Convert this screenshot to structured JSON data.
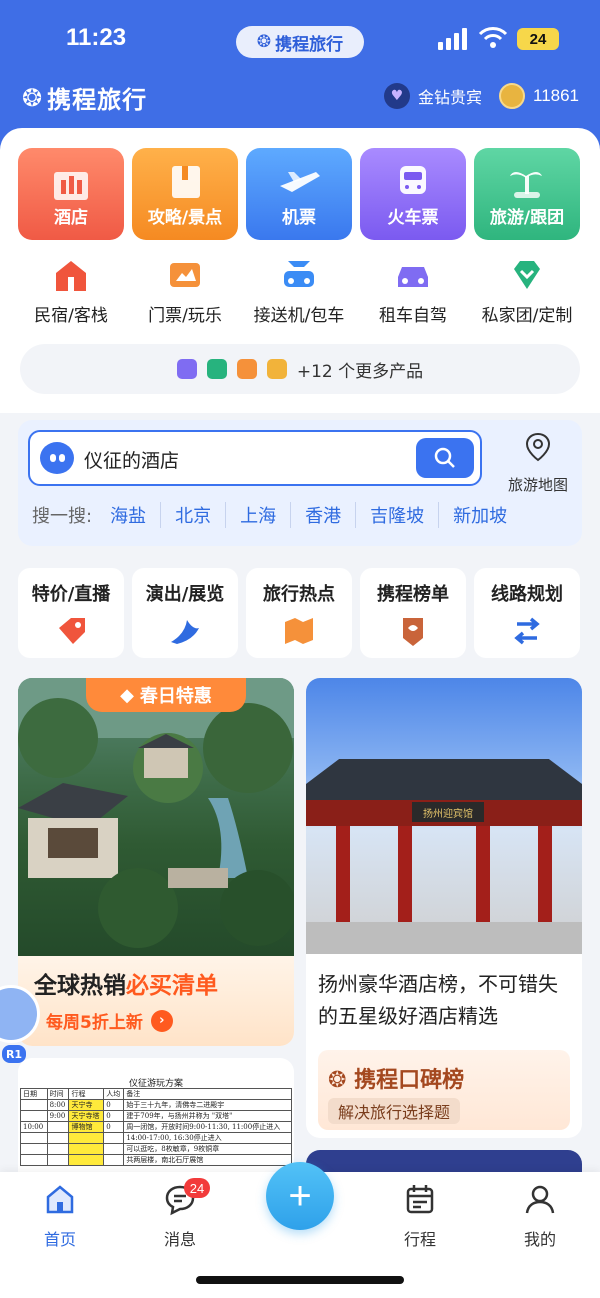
{
  "status_bar": {
    "time": "11:23",
    "battery": "24"
  },
  "header": {
    "app_pill": "携程旅行",
    "brand": "携程旅行",
    "vip_label": "金钻贵宾",
    "points": "11861"
  },
  "main_tiles": [
    {
      "label": "酒店",
      "icon": "hotel-icon"
    },
    {
      "label": "攻略/景点",
      "icon": "guide-icon"
    },
    {
      "label": "机票",
      "icon": "plane-icon"
    },
    {
      "label": "火车票",
      "icon": "train-icon"
    },
    {
      "label": "旅游/跟团",
      "icon": "palm-icon"
    }
  ],
  "sub_tiles": [
    {
      "label": "民宿/客栈",
      "icon": "house-icon"
    },
    {
      "label": "门票/玩乐",
      "icon": "ticket-icon"
    },
    {
      "label": "接送机/包车",
      "icon": "car-transfer-icon"
    },
    {
      "label": "租车自驾",
      "icon": "rental-car-icon"
    },
    {
      "label": "私家团/定制",
      "icon": "diamond-icon"
    }
  ],
  "more_products": "+12 个更多产品",
  "search": {
    "query": "仪征的酒店",
    "map_label": "旅游地图",
    "hot_label": "搜一搜:",
    "hot_keywords": [
      "海盐",
      "北京",
      "上海",
      "香港",
      "吉隆坡",
      "新加坡"
    ]
  },
  "quick_cards": [
    {
      "label": "特价/直播",
      "icon": "price-tag-icon"
    },
    {
      "label": "演出/展览",
      "icon": "show-icon"
    },
    {
      "label": "旅行热点",
      "icon": "map-fold-icon"
    },
    {
      "label": "携程榜单",
      "icon": "ranking-icon"
    },
    {
      "label": "线路规划",
      "icon": "route-icon"
    }
  ],
  "feed": {
    "left_tag": "春日特惠",
    "left_title_1": "全球热销",
    "left_title_2": "必买清单",
    "left_sub": "每周5折上新",
    "doc_title": "仪征游玩方案",
    "doc_header": [
      "日期",
      "时间",
      "行程",
      "人均",
      "备注"
    ],
    "doc_rows": [
      [
        "",
        "8:00",
        "天宁寺",
        "0",
        "始于三十九年，清佛寺二进殿宇"
      ],
      [
        "",
        "9:00",
        "天宁寺塔",
        "0",
        "建于709年，与扬州并称为 \"双塔\""
      ],
      [
        "10:00",
        "",
        "博物馆",
        "0",
        "周一闭馆，开放时间9:00-11:30, 11:00停止进入"
      ],
      [
        "",
        "",
        "",
        "",
        "14:00-17:00, 16:30停止进入"
      ],
      [
        "",
        "",
        "",
        "",
        "可以逛吃，8枚敏章，9枚铜章"
      ],
      [
        "",
        "",
        "",
        "",
        "共两层楼，南北石厅展馆"
      ]
    ],
    "right_sign": "扬州迎宾馆",
    "right_desc": "扬州豪华酒店榜，不可错失的五星级好酒店精选",
    "rank_title": "携程口碑榜",
    "rank_sub": "解决旅行选择题"
  },
  "mascot_badge": "R1",
  "bottom_nav": [
    {
      "label": "首页",
      "icon": "home-icon",
      "active": true
    },
    {
      "label": "消息",
      "icon": "message-icon",
      "badge": "24"
    },
    {
      "label": "",
      "icon": "plus-icon"
    },
    {
      "label": "行程",
      "icon": "calendar-icon"
    },
    {
      "label": "我的",
      "icon": "user-icon"
    }
  ],
  "colors": {
    "brand_blue": "#3f6ee6",
    "accent_orange": "#ff5a1f",
    "link_blue": "#2f6be0"
  }
}
